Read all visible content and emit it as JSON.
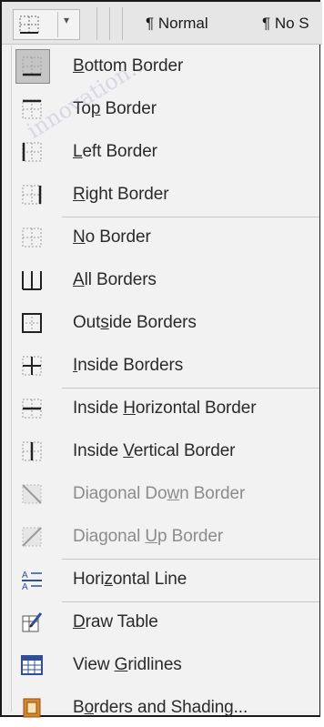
{
  "ribbon": {
    "styles": [
      "¶ Normal",
      "¶ No S"
    ]
  },
  "menu": {
    "items": [
      {
        "label_pre": "",
        "label_u": "B",
        "label_post": "ottom Border",
        "icon": "bottom-border-icon",
        "disabled": false,
        "selected": true
      },
      {
        "label_pre": "To",
        "label_u": "p",
        "label_post": " Border",
        "icon": "top-border-icon",
        "disabled": false
      },
      {
        "label_pre": "",
        "label_u": "L",
        "label_post": "eft Border",
        "icon": "left-border-icon",
        "disabled": false
      },
      {
        "label_pre": "",
        "label_u": "R",
        "label_post": "ight Border",
        "icon": "right-border-icon",
        "disabled": false
      },
      {
        "label_pre": "",
        "label_u": "N",
        "label_post": "o Border",
        "icon": "no-border-icon",
        "disabled": false
      },
      {
        "label_pre": "",
        "label_u": "A",
        "label_post": "ll Borders",
        "icon": "all-borders-icon",
        "disabled": false
      },
      {
        "label_pre": "Out",
        "label_u": "s",
        "label_post": "ide Borders",
        "icon": "outside-borders-icon",
        "disabled": false
      },
      {
        "label_pre": "",
        "label_u": "I",
        "label_post": "nside Borders",
        "icon": "inside-borders-icon",
        "disabled": false
      },
      {
        "label_pre": "Inside ",
        "label_u": "H",
        "label_post": "orizontal Border",
        "icon": "inside-horizontal-border-icon",
        "disabled": false
      },
      {
        "label_pre": "Inside ",
        "label_u": "V",
        "label_post": "ertical Border",
        "icon": "inside-vertical-border-icon",
        "disabled": false
      },
      {
        "label_pre": "Diagonal Do",
        "label_u": "w",
        "label_post": "n Border",
        "icon": "diagonal-down-border-icon",
        "disabled": true
      },
      {
        "label_pre": "Diagonal ",
        "label_u": "U",
        "label_post": "p Border",
        "icon": "diagonal-up-border-icon",
        "disabled": true
      },
      {
        "label_pre": "Hori",
        "label_u": "z",
        "label_post": "ontal Line",
        "icon": "horizontal-line-icon",
        "disabled": false
      },
      {
        "label_pre": "",
        "label_u": "D",
        "label_post": "raw Table",
        "icon": "draw-table-icon",
        "disabled": false
      },
      {
        "label_pre": "View ",
        "label_u": "G",
        "label_post": "ridlines",
        "icon": "view-gridlines-icon",
        "disabled": false
      },
      {
        "label_pre": "B",
        "label_u": "o",
        "label_post": "rders and Shading...",
        "icon": "borders-and-shading-icon",
        "disabled": false
      }
    ]
  },
  "colors": {
    "icon_gray": "#5a5a5a",
    "icon_blue": "#2f4f9a",
    "icon_orange": "#d9862a",
    "disabled_text": "#8c8c8c"
  }
}
